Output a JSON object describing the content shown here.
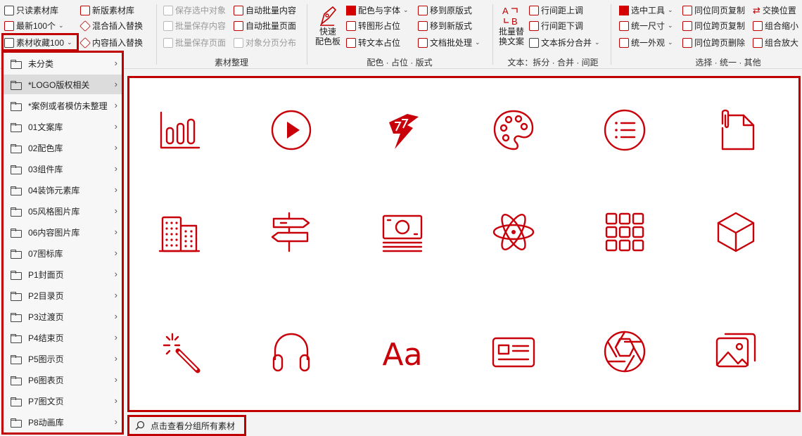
{
  "ribbon": {
    "col1": {
      "readonly": "只读素材库",
      "latest": "最新100个",
      "favorites": "素材收藏100",
      "newlib": "新版素材库",
      "mixinsert": "混合插入替换",
      "contentinsert": "内容插入替换"
    },
    "col2": {
      "save_selected": "保存选中对象",
      "batch_save_content": "批量保存内容",
      "batch_save_page": "批量保存页面",
      "auto_batch_content": "自动批量内容",
      "auto_batch_page": "自动批量页面",
      "object_page_dist": "对象分页分布",
      "group_label": "素材整理"
    },
    "col3": {
      "quick_color_line1": "快速",
      "quick_color_line2": "配色板",
      "color_font": "配色与字体",
      "to_shape": "转图形占位",
      "to_text": "转文本占位",
      "move_old": "移到原版式",
      "move_new": "移到新版式",
      "doc_batch": "文档批处理",
      "group_label": "配色 · 占位 · 版式"
    },
    "col4": {
      "batch_replace_line1": "批量替",
      "batch_replace_line2": "换文案",
      "line_up": "行间距上调",
      "line_down": "行间距下调",
      "text_split": "文本拆分合并",
      "group_label": "文本：拆分 · 合并 · 间距"
    },
    "col5": {
      "select_tool": "选中工具",
      "unify_size": "统一尺寸",
      "unify_look": "统一外观",
      "same_copy": "同位同页复制",
      "cross_copy": "同位跨页复制",
      "cross_delete": "同位跨页删除",
      "swap": "交换位置",
      "group_shrink": "组合缩小",
      "group_enlarge": "组合放大",
      "group_label": "选择 · 统一 · 其他"
    }
  },
  "menu": {
    "items": [
      "未分类",
      "*LOGO版权相关",
      "*案例或者模仿未整理",
      "01文案库",
      "02配色库",
      "03组件库",
      "04装饰元素库",
      "05风格图片库",
      "06内容图片库",
      "07图标库",
      "P1封面页",
      "P2目录页",
      "P3过渡页",
      "P4结束页",
      "P5图示页",
      "P6图表页",
      "P7图文页",
      "P8动画库"
    ],
    "selected_index": 1
  },
  "icons": [
    "bar-chart-icon",
    "play-circle-icon",
    "lightning-logo-icon",
    "palette-icon",
    "list-icon",
    "file-clip-icon",
    "buildings-icon",
    "signpost-icon",
    "banknote-icon",
    "atom-icon",
    "grid-icon",
    "cube-icon",
    "magic-wand-icon",
    "headphones-icon",
    "font-aa-icon",
    "id-card-icon",
    "aperture-icon",
    "images-icon"
  ],
  "icon_text": {
    "font_sample": "Aa"
  },
  "search": {
    "label": "点击查看分组所有素材"
  },
  "colors": {
    "accent": "#c00000",
    "icon": "#c8000a"
  }
}
